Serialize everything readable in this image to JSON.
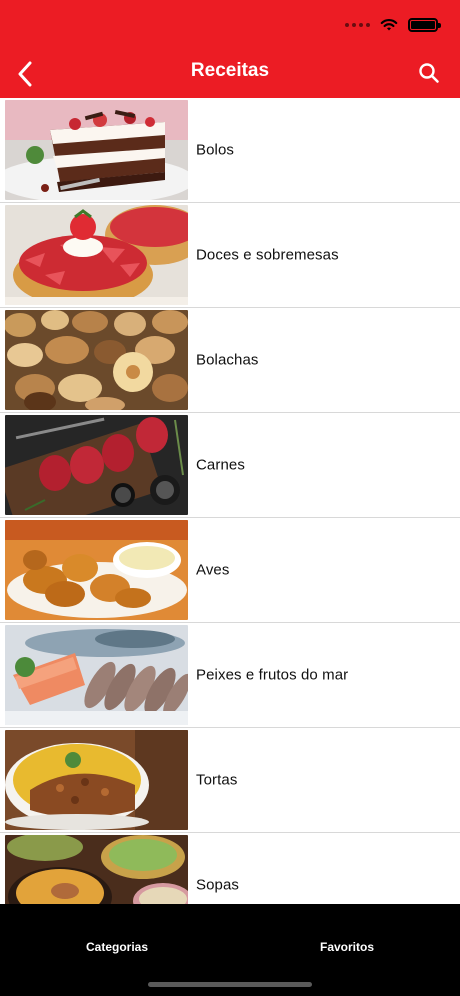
{
  "app": {
    "title": "Receitas"
  },
  "colors": {
    "header": "#ec1c24",
    "tabbar": "#000000",
    "separator": "#d8d8d8"
  },
  "header": {
    "back_icon": "chevron-left-icon",
    "search_icon": "search-icon"
  },
  "categories": [
    {
      "label": "Bolos",
      "image": "cake-slice-photo"
    },
    {
      "label": "Doces e sobremesas",
      "image": "strawberry-tart-photo"
    },
    {
      "label": "Bolachas",
      "image": "cookies-photo"
    },
    {
      "label": "Carnes",
      "image": "steaks-photo"
    },
    {
      "label": "Aves",
      "image": "fried-chicken-photo"
    },
    {
      "label": "Peixes e frutos do mar",
      "image": "salmon-shrimp-photo"
    },
    {
      "label": "Tortas",
      "image": "pie-photo"
    },
    {
      "label": "Sopas",
      "image": "soup-bowls-photo"
    }
  ],
  "tabbar": {
    "tabs": [
      {
        "label": "Categorias"
      },
      {
        "label": "Favoritos"
      }
    ]
  }
}
